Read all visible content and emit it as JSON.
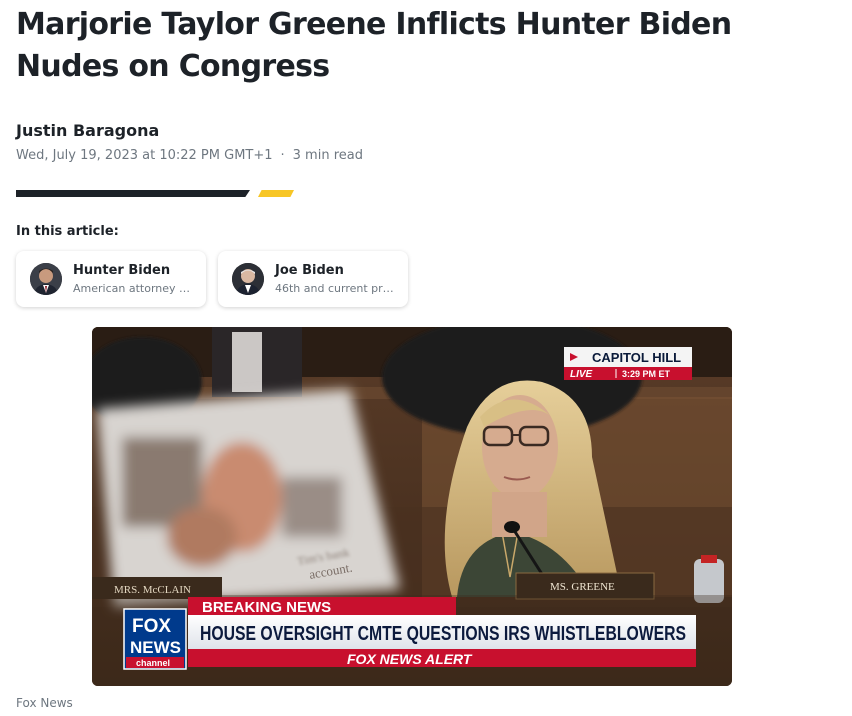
{
  "article": {
    "title": "Marjorie Taylor Greene Inflicts Hunter Biden Nudes on Congress",
    "author": "Justin Baragona",
    "date": "Wed, July 19, 2023 at 10:22 PM GMT+1",
    "separator": "·",
    "read_time": "3 min read"
  },
  "in_this_article": {
    "heading": "In this article:",
    "entities": [
      {
        "name": "Hunter Biden",
        "description": "American attorney …"
      },
      {
        "name": "Joe Biden",
        "description": "46th and current pr…"
      }
    ]
  },
  "media": {
    "caption": "Fox News",
    "broadcast": {
      "location": "CAPITOL HILL",
      "live": "LIVE",
      "time": "3:29 PM ET",
      "breaking": "BREAKING NEWS",
      "ticker_headline": "HOUSE OVERSIGHT CMTE QUESTIONS IRS WHISTLEBLOWERS",
      "alert": "FOX NEWS ALERT",
      "logo_line1": "FOX",
      "logo_line2": "NEWS",
      "logo_line3": "channel",
      "nameplate_left": "MRS. McCLAIN",
      "nameplate_right": "MS. GREENE",
      "poster_text_1": "Tim's bank",
      "poster_text_2": "account."
    }
  },
  "colors": {
    "accent_yellow": "#f7c626",
    "text_primary": "#1d2228",
    "text_secondary": "#6e7780",
    "fox_red": "#c8102e",
    "fox_blue": "#003a8c"
  }
}
